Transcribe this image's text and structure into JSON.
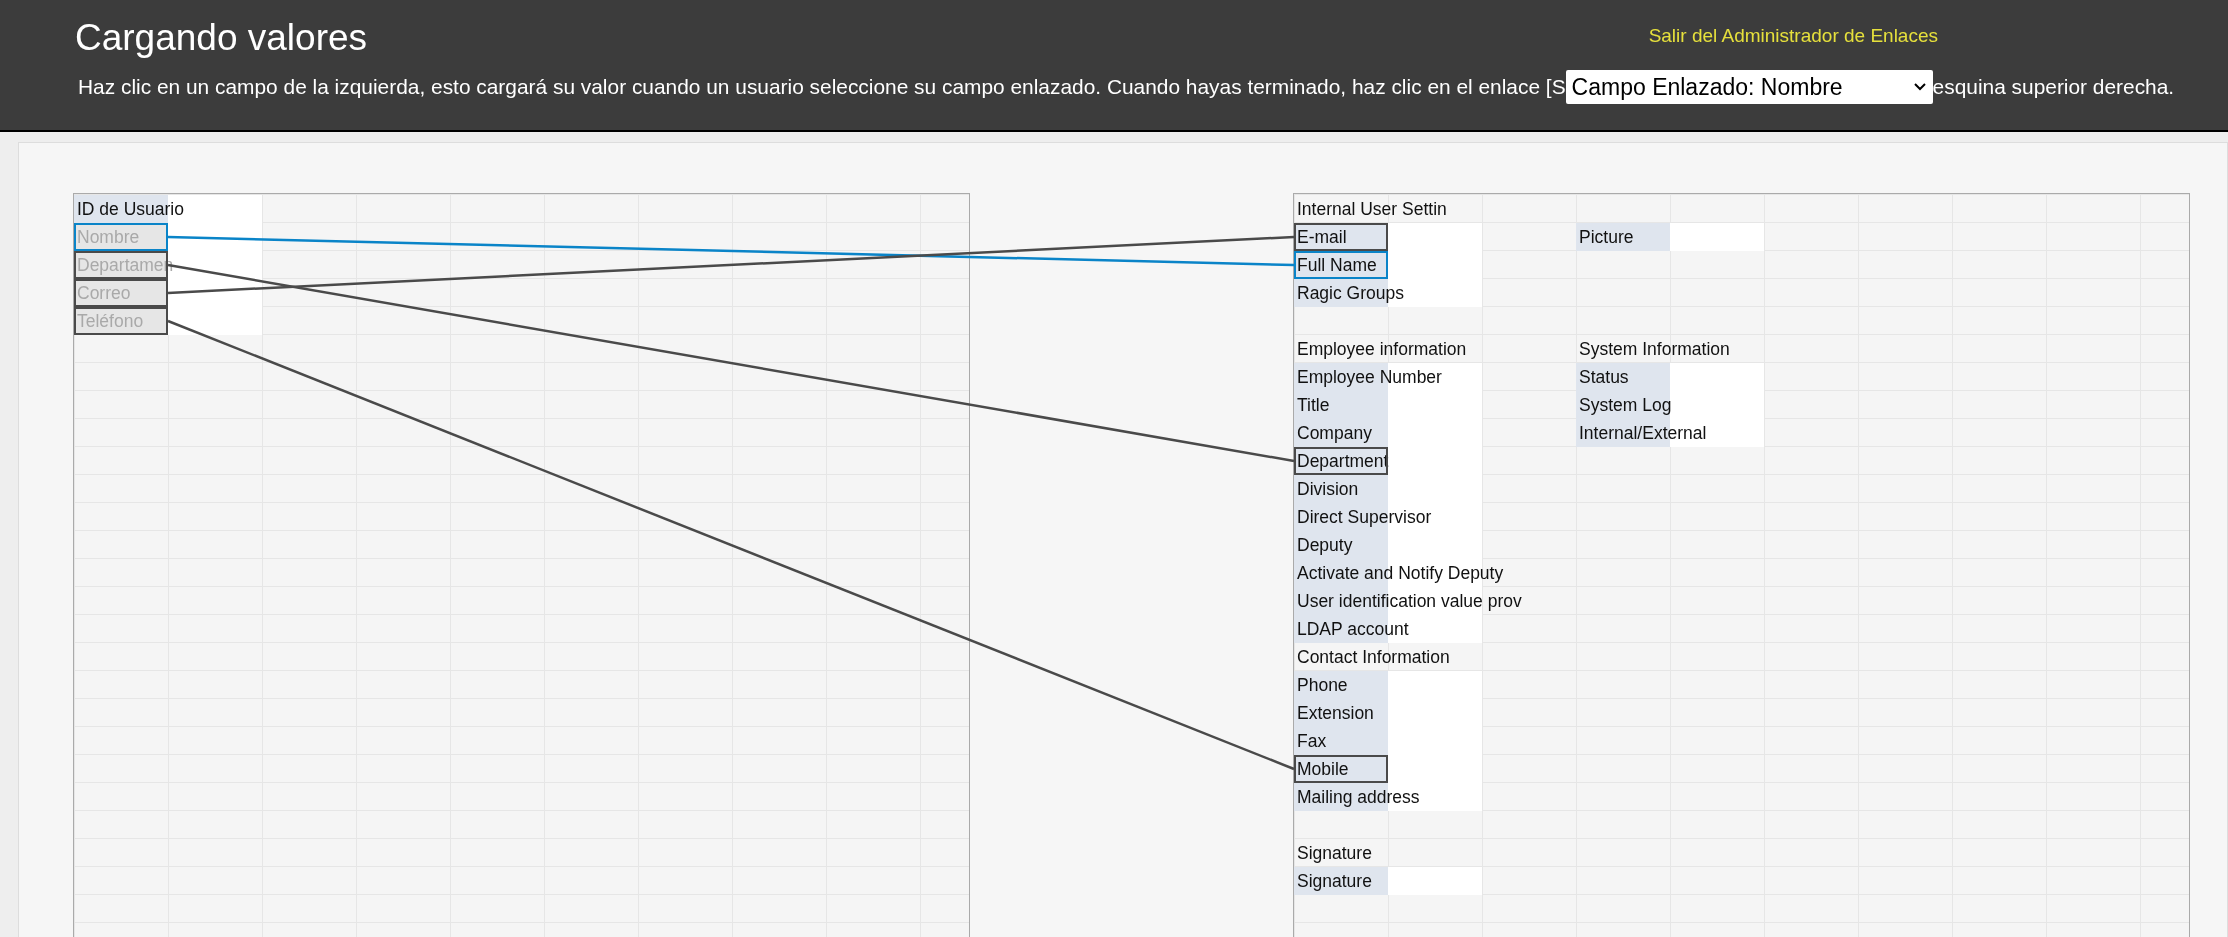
{
  "header": {
    "title": "Cargando valores",
    "exit_link": "Salir del Administrador de Enlaces",
    "instruction_before": "Haz clic en un campo de la izquierda, esto cargará su valor cuando un usuario seleccione su campo enlazado. Cuando hayas terminado, haz clic en el enlace [S",
    "linked_field_select": "Campo Enlazado: Nombre",
    "instruction_after": "esquina superior derecha."
  },
  "left_sheet": {
    "fields": [
      {
        "label": "ID de Usuario",
        "linked": false,
        "selected": false
      },
      {
        "label": "Nombre",
        "linked": true,
        "selected": true
      },
      {
        "label": "Departamen",
        "linked": true,
        "selected": false
      },
      {
        "label": "Correo",
        "linked": true,
        "selected": false
      },
      {
        "label": "Teléfono",
        "linked": true,
        "selected": false
      }
    ]
  },
  "right_sheet": {
    "rows": [
      {
        "left": {
          "kind": "section",
          "label": "Internal User Settin"
        }
      },
      {
        "left": {
          "kind": "field",
          "label": "E-mail",
          "linked": true
        },
        "right": {
          "kind": "field",
          "label": "Picture"
        }
      },
      {
        "left": {
          "kind": "field",
          "label": "Full Name",
          "linked": true
        }
      },
      {
        "left": {
          "kind": "field",
          "label": "Ragic Groups"
        }
      },
      {},
      {
        "left": {
          "kind": "section",
          "label": "Employee information"
        },
        "right": {
          "kind": "section",
          "label": "System Information"
        }
      },
      {
        "left": {
          "kind": "field",
          "label": "Employee Number"
        },
        "right": {
          "kind": "field",
          "label": "Status"
        }
      },
      {
        "left": {
          "kind": "field",
          "label": "Title"
        },
        "right": {
          "kind": "field",
          "label": "System Log"
        }
      },
      {
        "left": {
          "kind": "field",
          "label": "Company"
        },
        "right": {
          "kind": "field",
          "label": "Internal/External"
        }
      },
      {
        "left": {
          "kind": "field",
          "label": "Department",
          "linked": true
        }
      },
      {
        "left": {
          "kind": "field",
          "label": "Division"
        }
      },
      {
        "left": {
          "kind": "field",
          "label": "Direct Supervisor"
        }
      },
      {
        "left": {
          "kind": "field",
          "label": "Deputy"
        }
      },
      {
        "left": {
          "kind": "field",
          "label": "Activate and Notify Deputy"
        }
      },
      {
        "left": {
          "kind": "field",
          "label": "User identification value prov"
        }
      },
      {
        "left": {
          "kind": "field",
          "label": "LDAP account"
        }
      },
      {
        "left": {
          "kind": "section",
          "label": "Contact Information"
        }
      },
      {
        "left": {
          "kind": "field",
          "label": "Phone"
        }
      },
      {
        "left": {
          "kind": "field",
          "label": "Extension"
        }
      },
      {
        "left": {
          "kind": "field",
          "label": "Fax"
        }
      },
      {
        "left": {
          "kind": "field",
          "label": "Mobile",
          "linked": true
        }
      },
      {
        "left": {
          "kind": "field",
          "label": "Mailing address"
        }
      },
      {},
      {
        "left": {
          "kind": "section",
          "label": "Signature"
        }
      },
      {
        "left": {
          "kind": "field",
          "label": "Signature"
        }
      }
    ]
  }
}
